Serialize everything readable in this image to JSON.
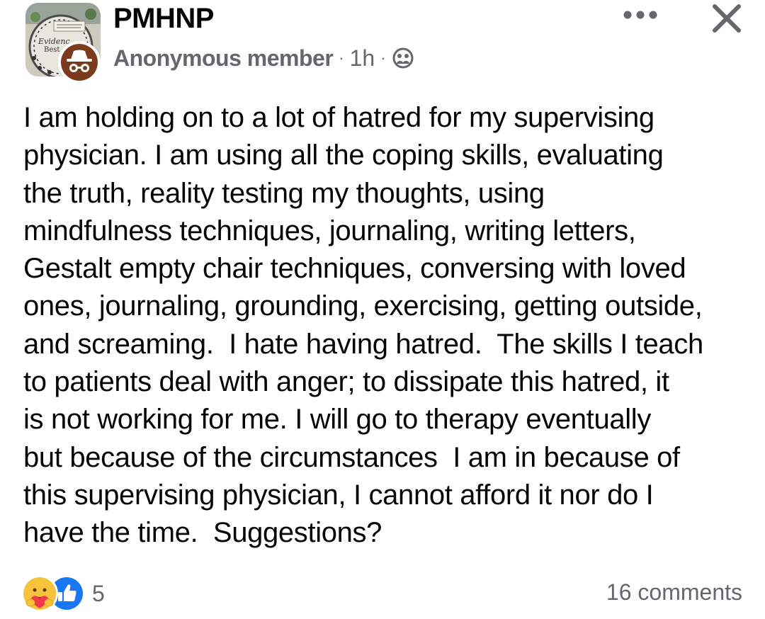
{
  "post": {
    "group_name": "PMHNP",
    "author": "Anonymous member",
    "time": "1h",
    "separator": "·",
    "body": "I am holding on to a lot of hatred for my supervising\nphysician. I am using all the coping skills, evaluating\nthe truth, reality testing my thoughts, using\nmindfulness techniques, journaling, writing letters,\nGestalt empty chair techniques, conversing with loved\nones, journaling, grounding, exercising, getting outside,\nand screaming.  I hate having hatred.  The skills I teach\nto patients deal with anger; to dissipate this hatred, it\nis not working for me. I will go to therapy eventually\nbut because of the circumstances  I am in because of\nthis supervising physician, I cannot afford it nor do I\nhave the time.  Suggestions?",
    "group_avatar_text": [
      "Evidenc",
      "Best"
    ],
    "privacy_icon": "group-members-icon",
    "author_avatar_icon": "anonymous-incognito-icon"
  },
  "header_actions": {
    "more_icon": "more-horizontal-icon",
    "close_icon": "close-icon"
  },
  "footer": {
    "reaction_icons": [
      "care-reaction-icon",
      "like-reaction-icon"
    ],
    "reaction_count": "5",
    "comments": "16 comments"
  },
  "colors": {
    "text_primary": "#050505",
    "text_secondary": "#65676b",
    "like_blue": "#1877f2",
    "care_yellow": "#f7c33b",
    "care_heart_red": "#f0374c",
    "anon_avatar_bg": "#7b3b1c"
  }
}
